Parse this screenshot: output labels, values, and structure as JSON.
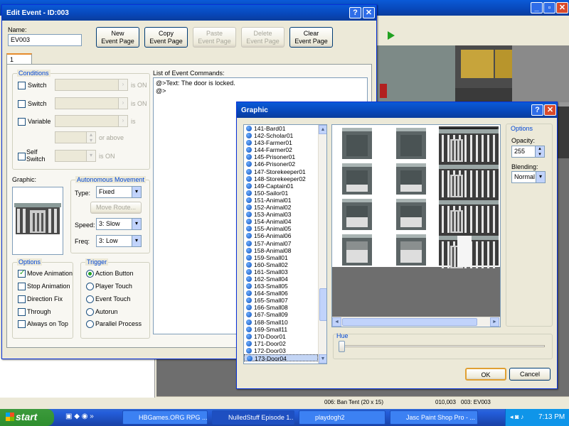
{
  "edit_event": {
    "title": "Edit Event - ID:003",
    "help": "?",
    "close": "✕",
    "name_label": "Name:",
    "name_value": "EV003",
    "buttons": {
      "new": "New\nEvent Page",
      "copy": "Copy\nEvent Page",
      "paste": "Paste\nEvent Page",
      "delete": "Delete\nEvent Page",
      "clear": "Clear\nEvent Page"
    },
    "tab": "1",
    "conditions": {
      "caption": "Conditions",
      "switch1": "Switch",
      "switch2": "Switch",
      "variable": "Variable",
      "self_switch": "Self\nSwitch",
      "is_on1": "is ON",
      "is_on2": "is ON",
      "is": "is",
      "or_above": "or above",
      "is_on3": "is ON"
    },
    "graphic_label": "Graphic:",
    "autonomous": {
      "caption": "Autonomous Movement",
      "type_label": "Type:",
      "type_value": "Fixed",
      "move_route": "Move Route...",
      "speed_label": "Speed:",
      "speed_value": "3: Slow",
      "freq_label": "Freq:",
      "freq_value": "3: Low"
    },
    "options": {
      "caption": "Options",
      "move_animation": "Move Animation",
      "stop_animation": "Stop Animation",
      "direction_fix": "Direction Fix",
      "through": "Through",
      "always_on_top": "Always on Top"
    },
    "trigger": {
      "caption": "Trigger",
      "action_button": "Action Button",
      "player_touch": "Player Touch",
      "event_touch": "Event Touch",
      "autorun": "Autorun",
      "parallel_process": "Parallel Process"
    },
    "commands": {
      "label": "List of Event Commands:",
      "line1": "@>Text: The door is locked.",
      "line2": "@>"
    }
  },
  "graphic_dialog": {
    "title": "Graphic",
    "help": "?",
    "close": "✕",
    "items": [
      "141-Bard01",
      "142-Scholar01",
      "143-Farmer01",
      "144-Farmer02",
      "145-Prisoner01",
      "146-Prisoner02",
      "147-Storekeeper01",
      "148-Storekeeper02",
      "149-Captain01",
      "150-Sailor01",
      "151-Animal01",
      "152-Animal02",
      "153-Animal03",
      "154-Animal04",
      "155-Animal05",
      "156-Animal06",
      "157-Animal07",
      "158-Animal08",
      "159-Small01",
      "160-Small02",
      "161-Small03",
      "162-Small04",
      "163-Small05",
      "164-Small06",
      "165-Small07",
      "166-Small08",
      "167-Small09",
      "168-Small10",
      "169-Small11",
      "170-Door01",
      "171-Door02",
      "172-Door03",
      "173-Door04"
    ],
    "selected": "173-Door04",
    "options_caption": "Options",
    "opacity_label": "Opacity:",
    "opacity_value": "255",
    "blending_label": "Blending:",
    "blending_value": "Normal",
    "hue_label": "Hue",
    "ok": "OK",
    "cancel": "Cancel"
  },
  "statusbar": {
    "map": "006: Ban Tent (20 x 15)",
    "coords": "010,003",
    "event": "003: EV003"
  },
  "taskbar": {
    "start": "start",
    "tasks": [
      "HBGames.ORG RPG ...",
      "NulledStuff Episode 1...",
      "playdogh2",
      "Jasc Paint Shop Pro - ..."
    ],
    "clock": "7:13 PM"
  },
  "colors": {
    "titlebar": "#0847b9",
    "accent": "#0046d5",
    "ok_border": "#e0a033"
  }
}
